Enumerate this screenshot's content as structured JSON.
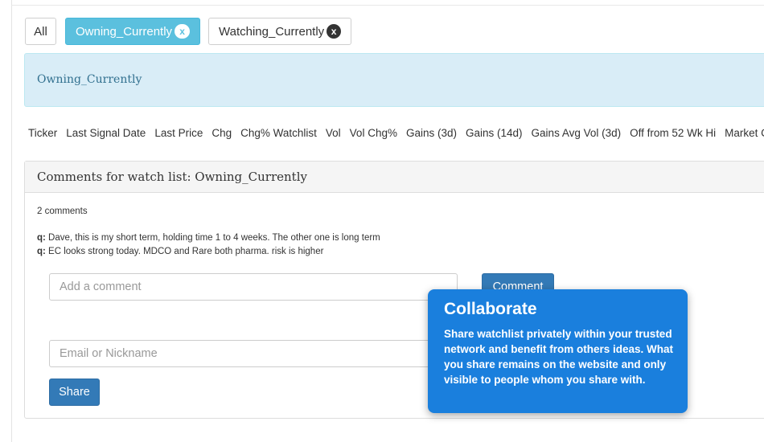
{
  "filter_tabs": {
    "all_label": "All",
    "owning_label": "Owning_Currently",
    "owning_badge": "x",
    "watching_label": "Watching_Currently",
    "watching_badge": "x"
  },
  "banner": {
    "title": "Owning_Currently"
  },
  "columns": [
    "Ticker",
    "Last Signal Date",
    "Last Price",
    "Chg",
    "Chg% Watchlist",
    "Vol",
    "Vol Chg%",
    "Gains (3d)",
    "Gains (14d)",
    "Gains Avg Vol (3d)",
    "Off from 52 Wk Hi",
    "Market Cap"
  ],
  "comments_panel": {
    "title": "Comments for watch list: Owning_Currently",
    "count": "2 comments",
    "comments": [
      {
        "author": "q:",
        "text": " Dave, this is my short term, holding time 1 to 4 weeks. The other one is long term"
      },
      {
        "author": "q:",
        "text": " EC looks strong today. MDCO and Rare both pharma. risk is higher"
      }
    ],
    "comment_placeholder": "Add a comment",
    "comment_button": "Comment",
    "email_placeholder": "Email or Nickname",
    "share_button": "Share"
  },
  "tooltip": {
    "title": "Collaborate",
    "body": "Share watchlist privately within your trusted network and benefit from others ideas.  What you share remains on the website and only visible to people whom you share with."
  },
  "colors": {
    "active_tab": "#5bc0de",
    "banner_bg": "#d9edf7",
    "primary_button": "#337ab7",
    "tooltip_bg": "#1a7fdd"
  }
}
